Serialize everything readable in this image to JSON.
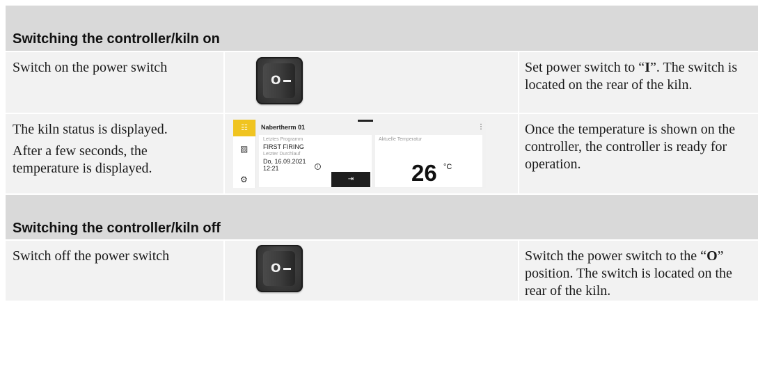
{
  "sections": [
    {
      "heading": "Switching the controller/kiln on",
      "rows": [
        {
          "left": "Switch on the power switch",
          "right_pre": "Set power switch to “",
          "right_bold": "I",
          "right_post": "”. The switch is located on the rear of the kiln.",
          "switch_mark_left": "O",
          "switch_mark_right": "—"
        },
        {
          "left_lines": [
            "The kiln status is displayed.",
            "After a few seconds, the temperature is displayed."
          ],
          "right": "Once the temperature is shown on the controller, the controller is ready for operation.",
          "screen": {
            "device_name": "Nabertherm 01",
            "last_program_label": "Letztes Programm",
            "last_program_value": "FIRST FIRING",
            "last_run_label": "Letzter Durchlauf",
            "last_run_date": "Do, 16.09.2021",
            "last_run_time": "12:21",
            "current_temp_label": "Aktuelle Temperatur",
            "current_temp_value": "26",
            "current_temp_unit": "°C",
            "icons": {
              "apps": "grid-icon",
              "chart": "chart-icon",
              "settings": "gear-icon",
              "menu": "kebab-icon",
              "info": "info-icon",
              "start": "start-icon"
            }
          }
        }
      ]
    },
    {
      "heading": "Switching the controller/kiln off",
      "rows": [
        {
          "left": "Switch off the power switch",
          "right_pre": "Switch the power switch to the “",
          "right_bold": "O",
          "right_post": "” position. The switch is located on the rear of the kiln.",
          "switch_mark_left": "O",
          "switch_mark_right": "—"
        }
      ]
    }
  ],
  "colors": {
    "heading_bg": "#d9d9d9",
    "cell_bg": "#f2f2f2",
    "accent_yellow": "#f0c420"
  }
}
